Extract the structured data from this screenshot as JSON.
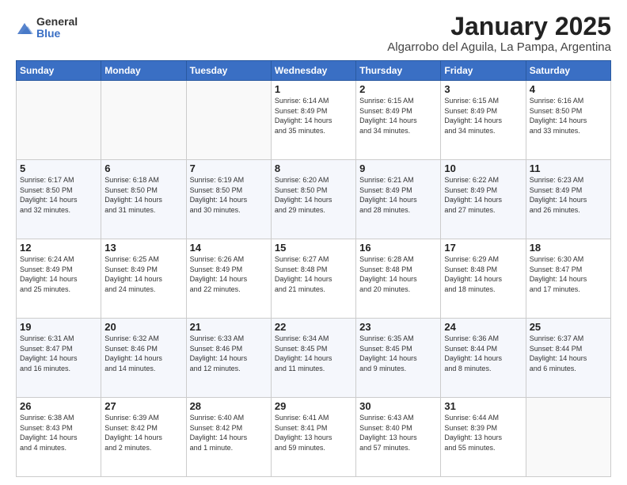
{
  "header": {
    "logo": {
      "general": "General",
      "blue": "Blue"
    },
    "title": "January 2025",
    "location": "Algarrobo del Aguila, La Pampa, Argentina"
  },
  "weekdays": [
    "Sunday",
    "Monday",
    "Tuesday",
    "Wednesday",
    "Thursday",
    "Friday",
    "Saturday"
  ],
  "weeks": [
    [
      {
        "day": "",
        "info": ""
      },
      {
        "day": "",
        "info": ""
      },
      {
        "day": "",
        "info": ""
      },
      {
        "day": "1",
        "info": "Sunrise: 6:14 AM\nSunset: 8:49 PM\nDaylight: 14 hours\nand 35 minutes."
      },
      {
        "day": "2",
        "info": "Sunrise: 6:15 AM\nSunset: 8:49 PM\nDaylight: 14 hours\nand 34 minutes."
      },
      {
        "day": "3",
        "info": "Sunrise: 6:15 AM\nSunset: 8:49 PM\nDaylight: 14 hours\nand 34 minutes."
      },
      {
        "day": "4",
        "info": "Sunrise: 6:16 AM\nSunset: 8:50 PM\nDaylight: 14 hours\nand 33 minutes."
      }
    ],
    [
      {
        "day": "5",
        "info": "Sunrise: 6:17 AM\nSunset: 8:50 PM\nDaylight: 14 hours\nand 32 minutes."
      },
      {
        "day": "6",
        "info": "Sunrise: 6:18 AM\nSunset: 8:50 PM\nDaylight: 14 hours\nand 31 minutes."
      },
      {
        "day": "7",
        "info": "Sunrise: 6:19 AM\nSunset: 8:50 PM\nDaylight: 14 hours\nand 30 minutes."
      },
      {
        "day": "8",
        "info": "Sunrise: 6:20 AM\nSunset: 8:50 PM\nDaylight: 14 hours\nand 29 minutes."
      },
      {
        "day": "9",
        "info": "Sunrise: 6:21 AM\nSunset: 8:49 PM\nDaylight: 14 hours\nand 28 minutes."
      },
      {
        "day": "10",
        "info": "Sunrise: 6:22 AM\nSunset: 8:49 PM\nDaylight: 14 hours\nand 27 minutes."
      },
      {
        "day": "11",
        "info": "Sunrise: 6:23 AM\nSunset: 8:49 PM\nDaylight: 14 hours\nand 26 minutes."
      }
    ],
    [
      {
        "day": "12",
        "info": "Sunrise: 6:24 AM\nSunset: 8:49 PM\nDaylight: 14 hours\nand 25 minutes."
      },
      {
        "day": "13",
        "info": "Sunrise: 6:25 AM\nSunset: 8:49 PM\nDaylight: 14 hours\nand 24 minutes."
      },
      {
        "day": "14",
        "info": "Sunrise: 6:26 AM\nSunset: 8:49 PM\nDaylight: 14 hours\nand 22 minutes."
      },
      {
        "day": "15",
        "info": "Sunrise: 6:27 AM\nSunset: 8:48 PM\nDaylight: 14 hours\nand 21 minutes."
      },
      {
        "day": "16",
        "info": "Sunrise: 6:28 AM\nSunset: 8:48 PM\nDaylight: 14 hours\nand 20 minutes."
      },
      {
        "day": "17",
        "info": "Sunrise: 6:29 AM\nSunset: 8:48 PM\nDaylight: 14 hours\nand 18 minutes."
      },
      {
        "day": "18",
        "info": "Sunrise: 6:30 AM\nSunset: 8:47 PM\nDaylight: 14 hours\nand 17 minutes."
      }
    ],
    [
      {
        "day": "19",
        "info": "Sunrise: 6:31 AM\nSunset: 8:47 PM\nDaylight: 14 hours\nand 16 minutes."
      },
      {
        "day": "20",
        "info": "Sunrise: 6:32 AM\nSunset: 8:46 PM\nDaylight: 14 hours\nand 14 minutes."
      },
      {
        "day": "21",
        "info": "Sunrise: 6:33 AM\nSunset: 8:46 PM\nDaylight: 14 hours\nand 12 minutes."
      },
      {
        "day": "22",
        "info": "Sunrise: 6:34 AM\nSunset: 8:45 PM\nDaylight: 14 hours\nand 11 minutes."
      },
      {
        "day": "23",
        "info": "Sunrise: 6:35 AM\nSunset: 8:45 PM\nDaylight: 14 hours\nand 9 minutes."
      },
      {
        "day": "24",
        "info": "Sunrise: 6:36 AM\nSunset: 8:44 PM\nDaylight: 14 hours\nand 8 minutes."
      },
      {
        "day": "25",
        "info": "Sunrise: 6:37 AM\nSunset: 8:44 PM\nDaylight: 14 hours\nand 6 minutes."
      }
    ],
    [
      {
        "day": "26",
        "info": "Sunrise: 6:38 AM\nSunset: 8:43 PM\nDaylight: 14 hours\nand 4 minutes."
      },
      {
        "day": "27",
        "info": "Sunrise: 6:39 AM\nSunset: 8:42 PM\nDaylight: 14 hours\nand 2 minutes."
      },
      {
        "day": "28",
        "info": "Sunrise: 6:40 AM\nSunset: 8:42 PM\nDaylight: 14 hours\nand 1 minute."
      },
      {
        "day": "29",
        "info": "Sunrise: 6:41 AM\nSunset: 8:41 PM\nDaylight: 13 hours\nand 59 minutes."
      },
      {
        "day": "30",
        "info": "Sunrise: 6:43 AM\nSunset: 8:40 PM\nDaylight: 13 hours\nand 57 minutes."
      },
      {
        "day": "31",
        "info": "Sunrise: 6:44 AM\nSunset: 8:39 PM\nDaylight: 13 hours\nand 55 minutes."
      },
      {
        "day": "",
        "info": ""
      }
    ]
  ]
}
